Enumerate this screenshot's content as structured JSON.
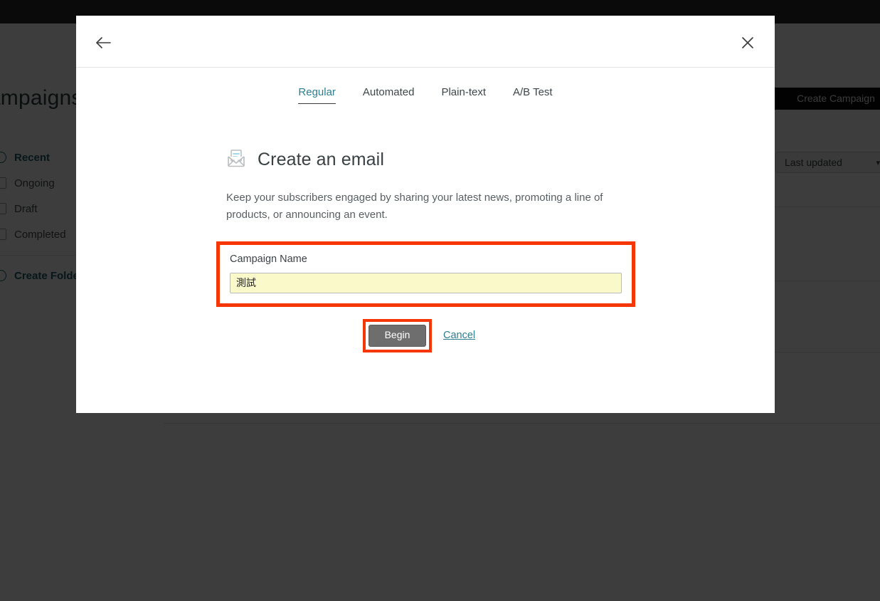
{
  "background": {
    "page_title": "Campaigns",
    "create_campaign_label": "Create Campaign",
    "sort_dropdown": {
      "value": "Last updated",
      "chevron": "chevron-down-icon"
    },
    "sidebar": {
      "items": [
        {
          "label": "Recent",
          "active": true
        },
        {
          "label": "Ongoing",
          "active": false
        },
        {
          "label": "Draft",
          "active": false
        },
        {
          "label": "Completed",
          "active": false
        }
      ],
      "create_folder_label": "Create Folder"
    }
  },
  "modal": {
    "back_icon": "arrow-left-icon",
    "close_icon": "close-icon",
    "tabs": [
      {
        "label": "Regular",
        "active": true
      },
      {
        "label": "Automated",
        "active": false
      },
      {
        "label": "Plain-text",
        "active": false
      },
      {
        "label": "A/B Test",
        "active": false
      }
    ],
    "heading_icon": "open-envelope-icon",
    "heading": "Create an email",
    "description": "Keep your subscribers engaged by sharing your latest news, promoting a line of products, or announcing an event.",
    "form": {
      "campaign_name_label": "Campaign Name",
      "campaign_name_value": "測試",
      "campaign_name_placeholder": ""
    },
    "begin_label": "Begin",
    "cancel_label": "Cancel"
  },
  "colors": {
    "accent_teal": "#2e7d91",
    "annotation_red": "#f73605",
    "autofill_yellow": "#f9f9ca",
    "button_gray": "#6e6e6e",
    "scrim": "rgba(0,0,0,0.76)"
  }
}
